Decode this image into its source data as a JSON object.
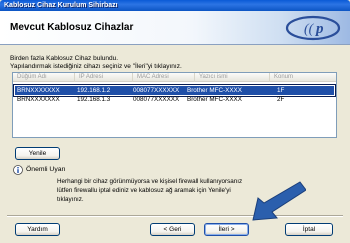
{
  "window": {
    "title": "Kablosuz Cihaz Kurulum Sihirbazı"
  },
  "header": {
    "title": "Mevcut Kablosuz Cihazlar",
    "logo_icon": "brother-wireless-logo"
  },
  "intro": {
    "line1": "Birden fazla Kablosuz Cihaz bulundu.",
    "line2": "Yapılandırmak istediğiniz cihazı seçiniz ve \"İleri\"yi tıklayınız."
  },
  "table": {
    "columns": [
      "Düğüm Adı",
      "IP Adresi",
      "MAC Adresi",
      "Yazıcı ismi",
      "Konum"
    ],
    "rows": [
      [
        "BRNXXXXXXX",
        "192.168.1.2",
        "008077XXXXXX",
        "Brother MFC-XXXX",
        "1F"
      ],
      [
        "BRNXXXXXXX",
        "192.168.1.3",
        "008077XXXXXX",
        "Brother MFC-XXXX",
        "2F"
      ]
    ],
    "selected_index": 0
  },
  "refresh_label": "Yenile",
  "note": {
    "title": "Önemli Uyarı",
    "line1": "Herhangi bir cihaz görünmüyorsa ve kişisel firewall kullanıyorsanız",
    "line2": "lütfen firewallu iptal ediniz ve kablosuz ağ aramak için Yenile'yi",
    "line3": "tıklayınız."
  },
  "buttons": {
    "help": "Yardım",
    "back": "< Geri",
    "next": "İleri >",
    "cancel": "İptal"
  }
}
